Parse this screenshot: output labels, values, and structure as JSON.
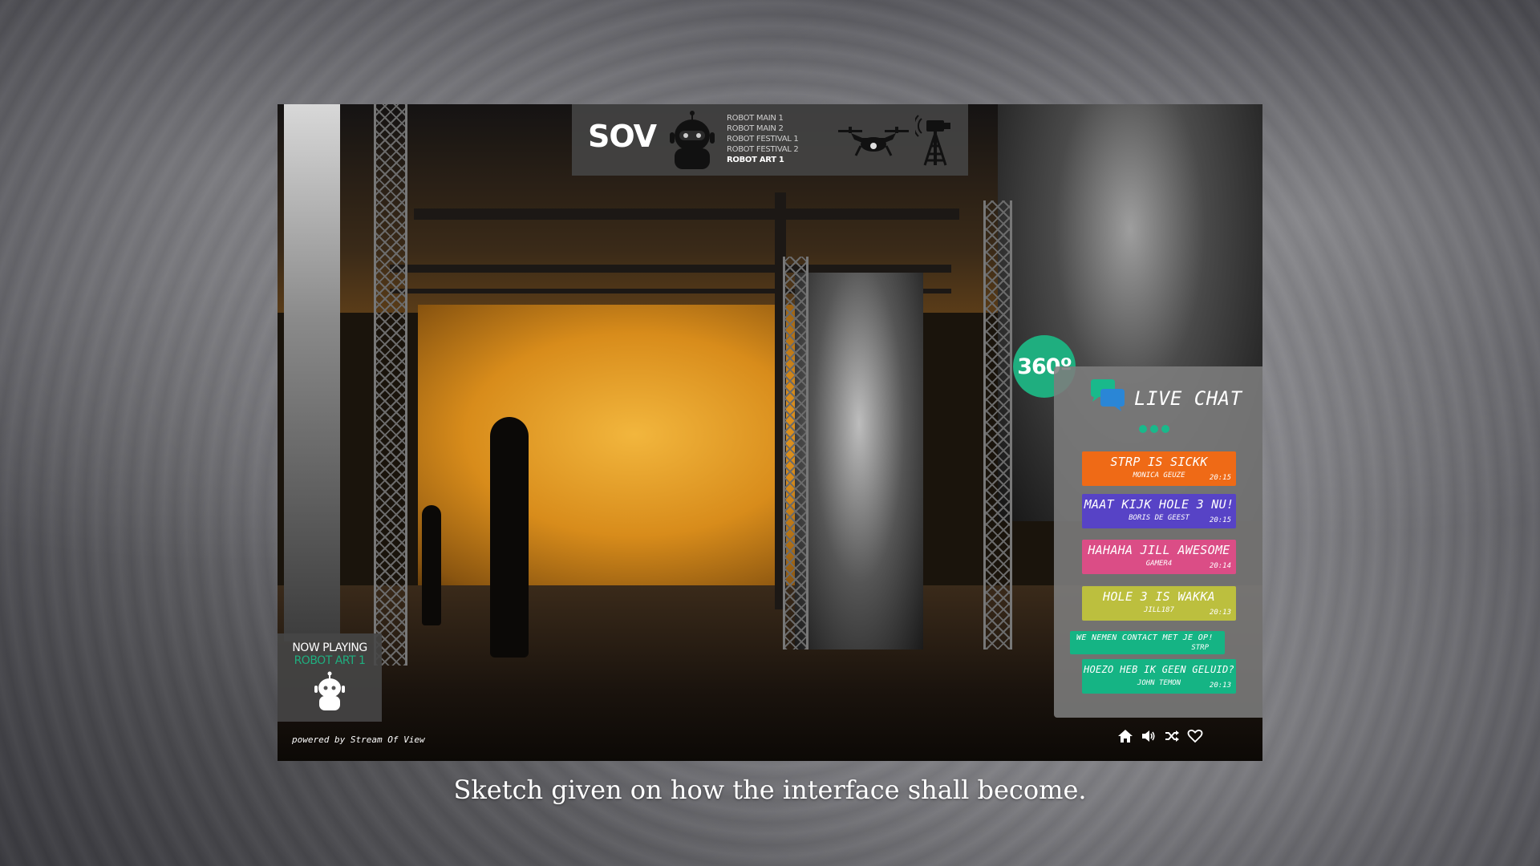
{
  "header": {
    "logo": "SOV",
    "channels": [
      "ROBOT MAIN 1",
      "ROBOT MAIN 2",
      "ROBOT FESTIVAL 1",
      "ROBOT FESTIVAL 2",
      "ROBOT ART 1"
    ],
    "active_channel": "ROBOT ART 1"
  },
  "badge": "360º",
  "chat": {
    "title": "LIVE CHAT",
    "messages": [
      {
        "text": "STRP IS SICKK",
        "user": "MONICA GEUZE",
        "time": "20:15",
        "color": "#ef6a16"
      },
      {
        "text": "MAAT KIJK HOLE 3 NU!",
        "user": "BORIS DE GEEST",
        "time": "20:15",
        "color": "#5743c6"
      },
      {
        "text": "HAHAHA JILL AWESOME",
        "user": "GAMER4",
        "time": "20:14",
        "color": "#db4d86"
      },
      {
        "text": "HOLE 3 IS WAKKA",
        "user": "JILL187",
        "time": "20:13",
        "color": "#bcbf3e"
      },
      {
        "text": "WE NEMEN CONTACT MET JE OP!",
        "user": "STRP",
        "time": "",
        "color": "#15b484"
      },
      {
        "text": "HOEZO HEB IK GEEN GELUID?",
        "user": "JOHN TEMON",
        "time": "20:13",
        "color": "#15b484"
      }
    ]
  },
  "now_playing": {
    "label": "NOW PLAYING",
    "channel": "ROBOT ART 1"
  },
  "powered_by": "powered by Stream Of View",
  "controls": [
    "home-icon",
    "volume-icon",
    "shuffle-icon",
    "heart-icon"
  ],
  "caption": "Sketch given on how the interface shall become.",
  "colors": {
    "accent": "#1fae7f",
    "panel": "#464646"
  }
}
